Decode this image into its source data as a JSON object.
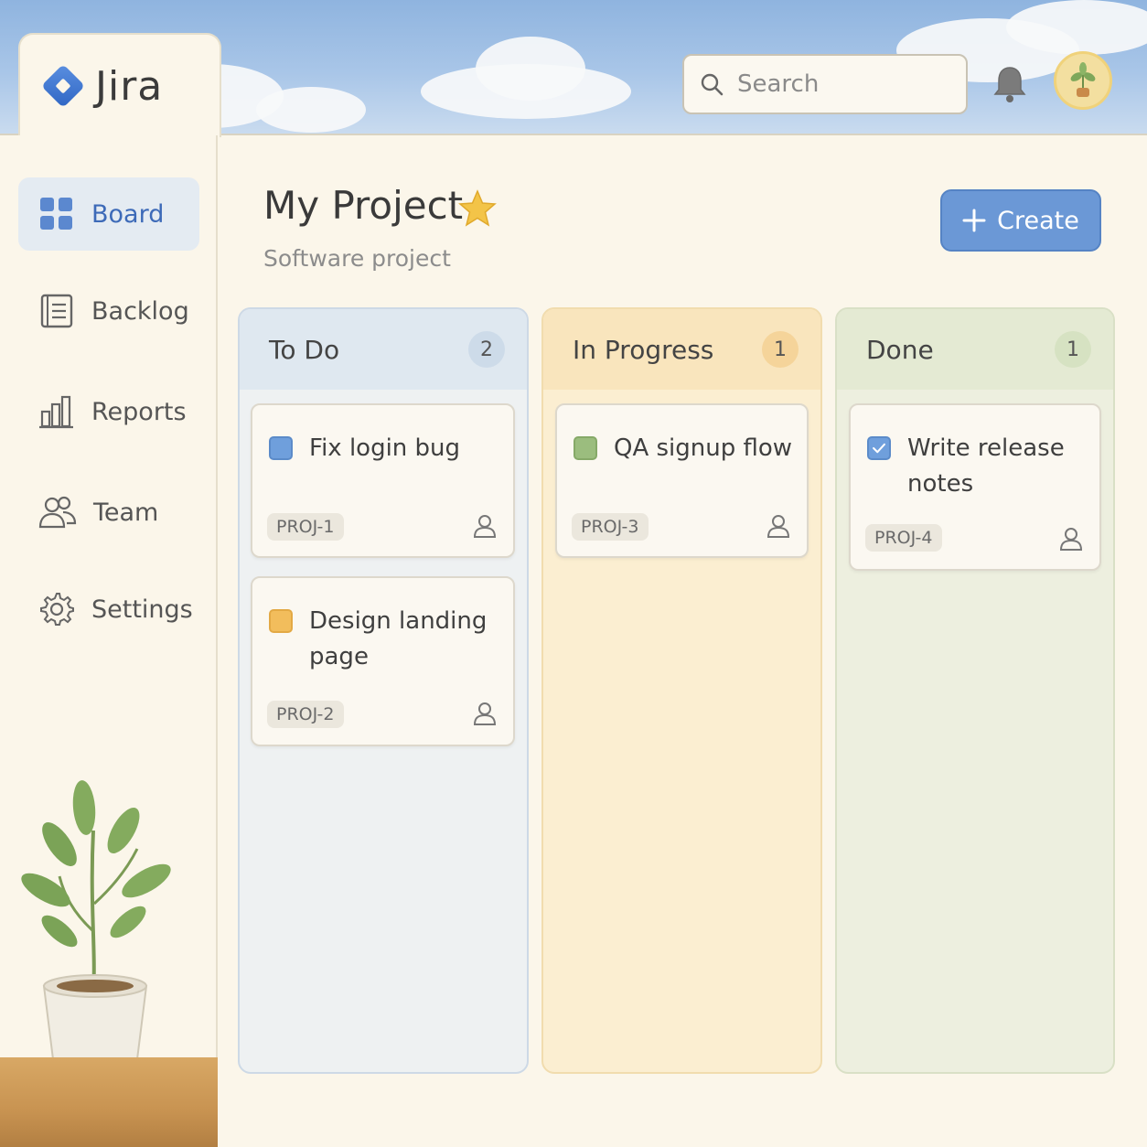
{
  "header": {
    "logo_text": "Jira",
    "search_placeholder": "Search",
    "bell_icon": "bell-icon",
    "avatar_icon": "plant-avatar"
  },
  "sidebar": {
    "items": [
      {
        "label": "Board",
        "icon": "grid-icon",
        "active": true
      },
      {
        "label": "Backlog",
        "icon": "list-icon",
        "active": false
      },
      {
        "label": "Reports",
        "icon": "bar-chart-icon",
        "active": false
      },
      {
        "label": "Team",
        "icon": "users-icon",
        "active": false
      },
      {
        "label": "Settings",
        "icon": "gear-icon",
        "active": false
      }
    ]
  },
  "project": {
    "title": "My Project",
    "subtitle": "Software project",
    "create_label": "Create"
  },
  "columns": [
    {
      "name": "To Do",
      "count": "2",
      "cards": [
        {
          "title": "Fix login bug",
          "key": "PROJ-1",
          "color": "#6f9fdc"
        },
        {
          "title": "Design landing page",
          "title_line1": "Design landing",
          "title_line2": "page",
          "key": "PROJ-2",
          "color": "#f2bd5c"
        }
      ]
    },
    {
      "name": "In Progress",
      "count": "1",
      "cards": [
        {
          "title": "QA signup flow",
          "key": "PROJ-3",
          "color": "#9bbd7e"
        }
      ]
    },
    {
      "name": "Done",
      "count": "1",
      "cards": [
        {
          "title": "Write release notes",
          "title_line1": "Write release",
          "title_line2": "notes",
          "key": "PROJ-4",
          "color": "#6f9fdc",
          "checked": true
        }
      ]
    }
  ],
  "colors": {
    "accent": "#6b98d6",
    "todo": "#dfe8f0",
    "in_progress": "#f9e5bd",
    "done": "#e4ead3"
  }
}
